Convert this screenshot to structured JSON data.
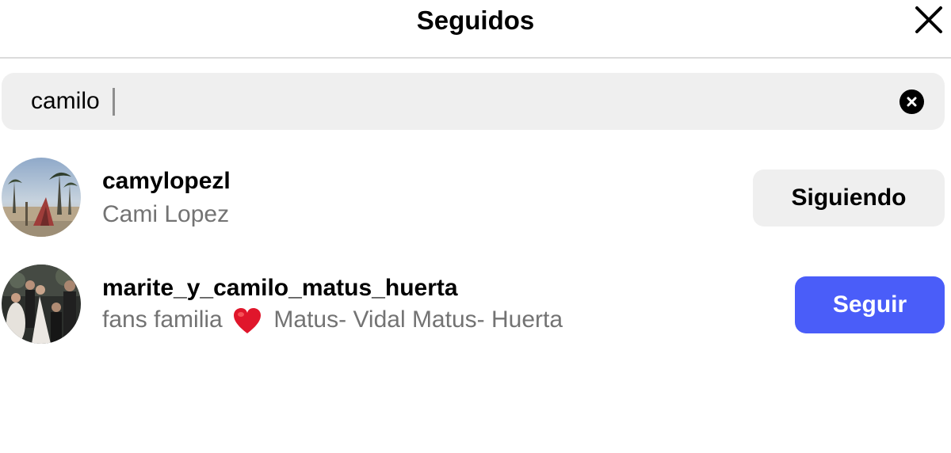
{
  "dialog": {
    "title": "Seguidos",
    "close_icon": "close-icon"
  },
  "search": {
    "value": "camilo",
    "clear_icon": "clear-circle-icon"
  },
  "results": [
    {
      "username": "camylopezl",
      "fullname": "Cami Lopez",
      "button_label": "Siguiendo",
      "button_state": "following"
    },
    {
      "username": "marite_y_camilo_matus_huerta",
      "fullname_before": "fans familia",
      "fullname_after": "Matus- Vidal Matus- Huerta",
      "emoji": "heart-icon",
      "button_label": "Seguir",
      "button_state": "not-following"
    }
  ],
  "colors": {
    "follow_button": "#4a5df9",
    "following_button": "#efefef",
    "secondary_text": "#737373",
    "search_background": "#efefef",
    "heart": "#e0162b"
  }
}
